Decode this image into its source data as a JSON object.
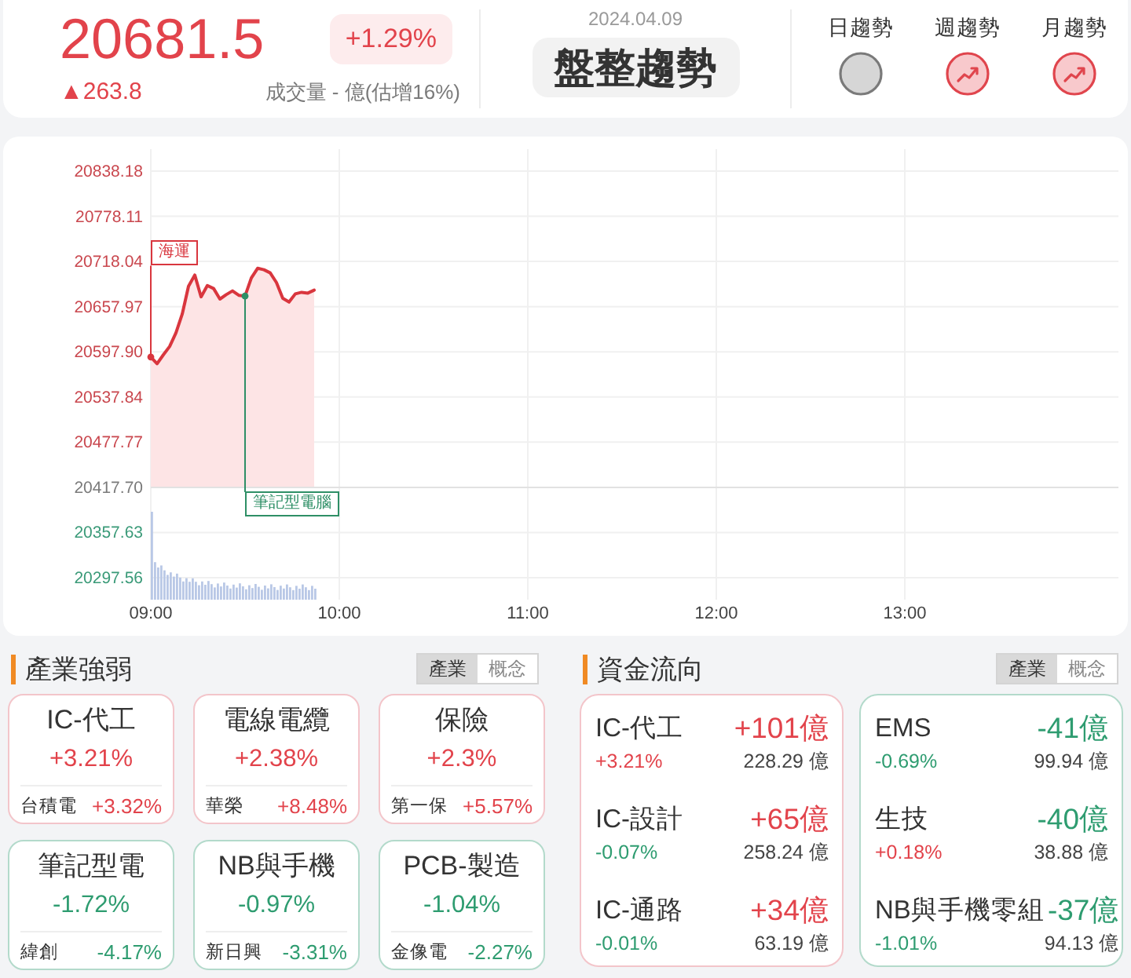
{
  "quote": {
    "price": "20681.5",
    "change_pct": "+1.29%",
    "change": "▲263.8",
    "volume": "成交量 - 億(估增16%)",
    "rising": true
  },
  "market": {
    "date": "2024.04.09",
    "status": "盤整趨勢"
  },
  "trends": [
    {
      "label": "日趨勢",
      "kind": "flat"
    },
    {
      "label": "週趨勢",
      "kind": "up"
    },
    {
      "label": "月趨勢",
      "kind": "up"
    }
  ],
  "chart": {
    "chart_data": {
      "type": "area",
      "grid": true,
      "categories": [
        "09:00",
        null,
        null,
        null,
        null,
        null,
        null,
        null,
        null,
        null,
        null,
        null,
        null,
        null,
        null,
        null,
        null,
        null,
        null,
        null,
        null,
        null,
        null,
        null,
        null,
        null,
        null,
        null,
        null,
        null,
        "10:00",
        null,
        null,
        null,
        null,
        null,
        null,
        null,
        null,
        null,
        null,
        null,
        null,
        null,
        null,
        null,
        null,
        null,
        null,
        null,
        null,
        null,
        null,
        null,
        null,
        null,
        null,
        null,
        null,
        null,
        "11:00",
        null,
        null,
        null,
        null,
        null,
        null,
        null,
        null,
        null,
        null,
        null,
        null,
        null,
        null,
        null,
        null,
        null,
        null,
        null,
        null,
        null,
        null,
        null,
        null,
        null,
        null,
        null,
        null,
        null,
        "12:00",
        null,
        null,
        null,
        null,
        null,
        null,
        null,
        null,
        null,
        null,
        null,
        null,
        null,
        null,
        null,
        null,
        null,
        null,
        null,
        null,
        null,
        null,
        null,
        null,
        null,
        null,
        null,
        null,
        null,
        "13:00",
        null,
        null,
        null,
        null,
        null,
        null,
        null,
        null,
        null,
        null,
        null,
        null,
        null,
        null,
        null,
        null,
        null,
        null,
        null,
        null,
        null,
        null,
        null,
        null,
        null,
        null,
        null,
        null,
        null,
        null
      ],
      "series": [
        {
          "color": "#d9363e",
          "values": [
            20591,
            20582,
            20594,
            20605,
            20623,
            20648,
            20685,
            20700,
            20671,
            20686,
            20682,
            20668,
            20674,
            20679,
            20673,
            20672,
            20696,
            20709,
            20707,
            20703,
            20690,
            20669,
            20664,
            20675,
            20677,
            20676,
            20680,
            null,
            null,
            null,
            null,
            null,
            null,
            null,
            null,
            null,
            null,
            null,
            null,
            null,
            null,
            null,
            null,
            null,
            null,
            null,
            null,
            null,
            null,
            null,
            null,
            null,
            null,
            null,
            null,
            null,
            null,
            null,
            null,
            null,
            null,
            null,
            null,
            null,
            null,
            null,
            null,
            null,
            null,
            null,
            null,
            null,
            null,
            null,
            null,
            null,
            null,
            null,
            null,
            null,
            null,
            null,
            null,
            null,
            null,
            null,
            null,
            null,
            null,
            null,
            null,
            null,
            null,
            null,
            null,
            null,
            null,
            null,
            null,
            null,
            null,
            null,
            null,
            null,
            null,
            null,
            null,
            null,
            null,
            null,
            null,
            null,
            null,
            null,
            null,
            null,
            null,
            null,
            null,
            null,
            null,
            null,
            null,
            null,
            null,
            null,
            null,
            null,
            null,
            null,
            null,
            null,
            null,
            null,
            null,
            null,
            null,
            null,
            null,
            null,
            null,
            null,
            null,
            null,
            null,
            null,
            null,
            null,
            null,
            null,
            null
          ]
        }
      ],
      "ylim": [
        20268.36,
        20867.38
      ],
      "yticks": [
        {
          "value": 20838.18,
          "label": "20838.18"
        },
        {
          "value": 20778.11,
          "label": "20778.11"
        },
        {
          "value": 20718.04,
          "label": "20718.04"
        },
        {
          "value": 20657.97,
          "label": "20657.97"
        },
        {
          "value": 20597.9,
          "label": "20597.90"
        },
        {
          "value": 20537.84,
          "label": "20537.84"
        },
        {
          "value": 20477.77,
          "label": "20477.77"
        },
        {
          "value": 20417.7,
          "label": "20417.70"
        },
        {
          "value": 20357.63,
          "label": "20357.63"
        },
        {
          "value": 20297.56,
          "label": "20297.56"
        }
      ],
      "ref_lines": [
        {
          "axis": "y",
          "value": 20417.7
        }
      ],
      "annotations": [
        "海運",
        "筆記型電腦"
      ]
    },
    "annotation_states": [
      {
        "rising": true
      },
      {
        "rising": false
      }
    ]
  },
  "industry_strength": {
    "title": "產業強弱",
    "tabs": [
      {
        "label": "產業",
        "selected": true
      },
      {
        "label": "概念",
        "selected": false
      }
    ],
    "cards": [
      {
        "name": "IC-代工",
        "change": "+3.21%",
        "rising": true,
        "top_stock": {
          "name": "台積電",
          "change": "+3.32%",
          "rising": true
        }
      },
      {
        "name": "電線電纜",
        "change": "+2.38%",
        "rising": true,
        "top_stock": {
          "name": "華榮",
          "change": "+8.48%",
          "rising": true
        }
      },
      {
        "name": "保險",
        "change": "+2.3%",
        "rising": true,
        "top_stock": {
          "name": "第一保",
          "change": "+5.57%",
          "rising": true
        }
      },
      {
        "name": "筆記型電",
        "change": "-1.72%",
        "rising": false,
        "top_stock": {
          "name": "緯創",
          "change": "-4.17%",
          "rising": false
        }
      },
      {
        "name": "NB與手機",
        "change": "-0.97%",
        "rising": false,
        "top_stock": {
          "name": "新日興",
          "change": "-3.31%",
          "rising": false
        }
      },
      {
        "name": "PCB-製造",
        "change": "-1.04%",
        "rising": false,
        "top_stock": {
          "name": "金像電",
          "change": "-2.27%",
          "rising": false
        }
      }
    ]
  },
  "fund_flow": {
    "title": "資金流向",
    "tabs": [
      {
        "label": "產業",
        "selected": true
      },
      {
        "label": "概念",
        "selected": false
      }
    ],
    "groups": [
      {
        "inflow": true,
        "rows": [
          {
            "name": "IC-代工",
            "amount": "+101億",
            "amount_rising": true,
            "change": "+3.21%",
            "change_rising": true,
            "turnover": "228.29 億"
          },
          {
            "name": "IC-設計",
            "amount": "+65億",
            "amount_rising": true,
            "change": "-0.07%",
            "change_rising": false,
            "turnover": "258.24 億"
          },
          {
            "name": "IC-通路",
            "amount": "+34億",
            "amount_rising": true,
            "change": "-0.01%",
            "change_rising": false,
            "turnover": "63.19 億"
          }
        ]
      },
      {
        "inflow": false,
        "rows": [
          {
            "name": "EMS",
            "amount": "-41億",
            "amount_rising": false,
            "change": "-0.69%",
            "change_rising": false,
            "turnover": "99.94 億"
          },
          {
            "name": "生技",
            "amount": "-40億",
            "amount_rising": false,
            "change": "+0.18%",
            "change_rising": true,
            "turnover": "38.88 億"
          },
          {
            "name": "NB與手機零組",
            "amount": "-37億",
            "amount_rising": false,
            "change": "-1.01%",
            "change_rising": false,
            "turnover": "94.13 億"
          }
        ]
      }
    ]
  }
}
